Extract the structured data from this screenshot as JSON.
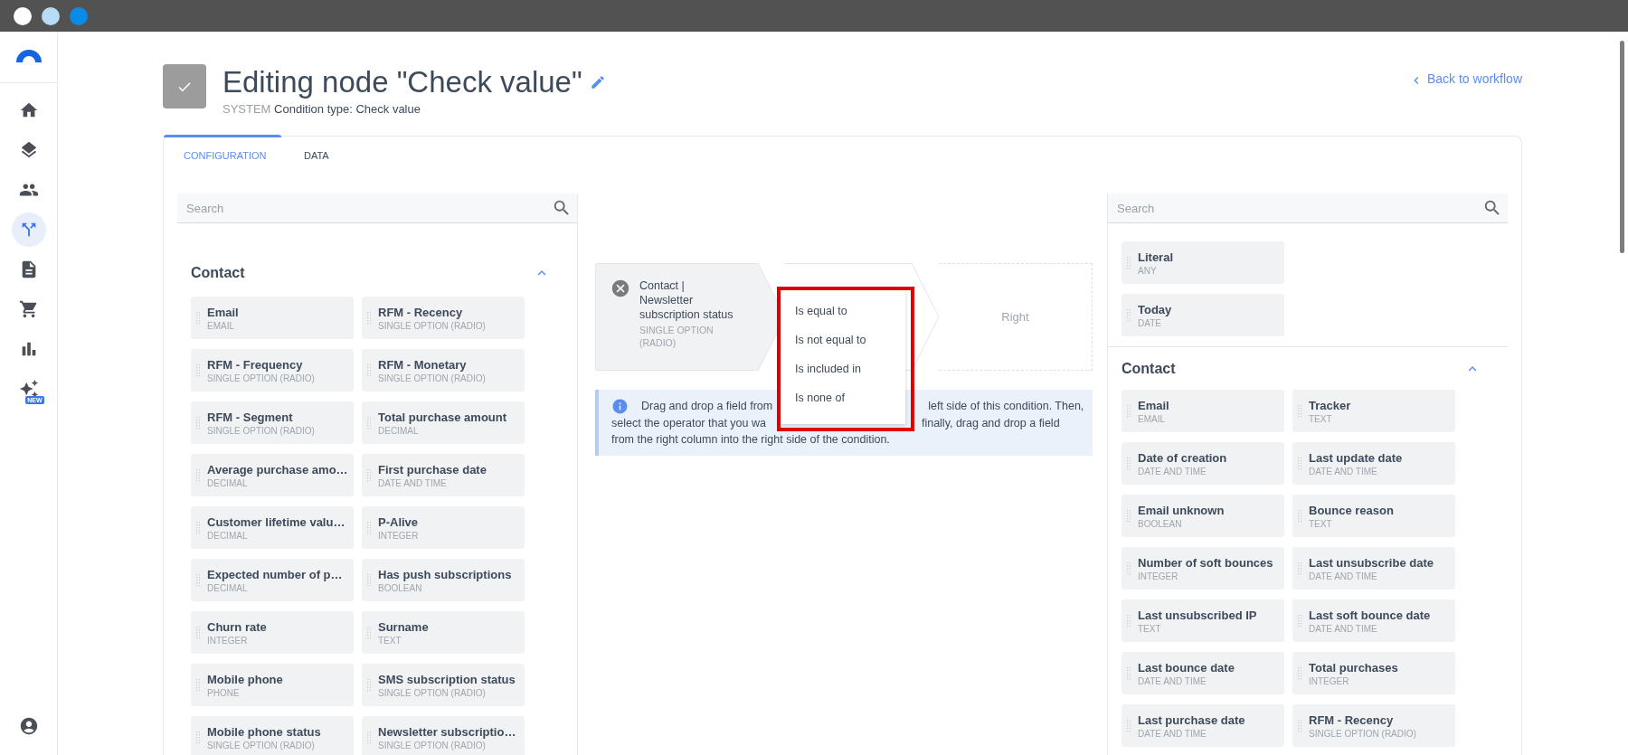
{
  "sidebar": {
    "items": [
      {
        "kind": "home",
        "selected": false
      },
      {
        "kind": "layers",
        "selected": false
      },
      {
        "kind": "people",
        "selected": false
      },
      {
        "kind": "branch",
        "selected": true
      },
      {
        "kind": "document",
        "selected": false
      },
      {
        "kind": "cart",
        "selected": false
      },
      {
        "kind": "chart",
        "selected": false
      },
      {
        "kind": "sparkles",
        "selected": false,
        "badge": "NEW"
      }
    ]
  },
  "header": {
    "title": "Editing node \"Check value\"",
    "subtitle_prefix": "SYSTEM",
    "subtitle": "Condition type: Check value",
    "back_link": "Back to workflow"
  },
  "tabs": [
    {
      "label": "CONFIGURATION",
      "selected": true
    },
    {
      "label": "DATA",
      "selected": false
    }
  ],
  "left_panel": {
    "search_placeholder": "Search",
    "section": {
      "title": "Contact",
      "expanded": true,
      "fields": [
        {
          "name": "Email",
          "type": "EMAIL"
        },
        {
          "name": "RFM - Recency",
          "type": "SINGLE OPTION (RADIO)"
        },
        {
          "name": "RFM - Frequency",
          "type": "SINGLE OPTION (RADIO)"
        },
        {
          "name": "RFM - Monetary",
          "type": "SINGLE OPTION (RADIO)"
        },
        {
          "name": "RFM - Segment",
          "type": "SINGLE OPTION (RADIO)"
        },
        {
          "name": "Total purchase amount",
          "type": "DECIMAL"
        },
        {
          "name": "Average purchase amo…",
          "type": "DECIMAL"
        },
        {
          "name": "First purchase date",
          "type": "DATE AND TIME"
        },
        {
          "name": "Customer lifetime valu…",
          "type": "DECIMAL"
        },
        {
          "name": "P-Alive",
          "type": "INTEGER"
        },
        {
          "name": "Expected number of p…",
          "type": "DECIMAL"
        },
        {
          "name": "Has push subscriptions",
          "type": "BOOLEAN"
        },
        {
          "name": "Churn rate",
          "type": "INTEGER"
        },
        {
          "name": "Surname",
          "type": "TEXT"
        },
        {
          "name": "Mobile phone",
          "type": "PHONE"
        },
        {
          "name": "SMS subscription status",
          "type": "SINGLE OPTION (RADIO)"
        },
        {
          "name": "Mobile phone status",
          "type": "SINGLE OPTION (RADIO)"
        },
        {
          "name": "Newsletter subscriptio…",
          "type": "SINGLE OPTION (RADIO)"
        }
      ]
    }
  },
  "condition": {
    "left": {
      "title": "Contact | Newsletter subscription status",
      "type": "SINGLE OPTION (RADIO)"
    },
    "right_placeholder": "Right"
  },
  "operator_menu": {
    "options": [
      "Is equal to",
      "Is not equal to",
      "Is included in",
      "Is none of"
    ]
  },
  "info": {
    "lines": [
      [
        "Drag and drop a field from",
        "left side of this condition. Then,"
      ],
      [
        "select the operator that you wa",
        "finally, drag and drop a field"
      ],
      [
        "from the right column into the right side of the condition."
      ]
    ]
  },
  "right_panel": {
    "search_placeholder": "Search",
    "constants": [
      {
        "name": "Literal",
        "type": "ANY"
      },
      {
        "name": "Today",
        "type": "DATE"
      }
    ],
    "section": {
      "title": "Contact",
      "expanded": true,
      "fields": [
        {
          "name": "Email",
          "type": "EMAIL"
        },
        {
          "name": "Tracker",
          "type": "TEXT"
        },
        {
          "name": "Date of creation",
          "type": "DATE AND TIME"
        },
        {
          "name": "Last update date",
          "type": "DATE AND TIME"
        },
        {
          "name": "Email unknown",
          "type": "BOOLEAN"
        },
        {
          "name": "Bounce reason",
          "type": "TEXT"
        },
        {
          "name": "Number of soft bounces",
          "type": "INTEGER"
        },
        {
          "name": "Last unsubscribe date",
          "type": "DATE AND TIME"
        },
        {
          "name": "Last unsubscribed IP",
          "type": "TEXT"
        },
        {
          "name": "Last soft bounce date",
          "type": "DATE AND TIME"
        },
        {
          "name": "Last bounce date",
          "type": "DATE AND TIME"
        },
        {
          "name": "Total purchases",
          "type": "INTEGER"
        },
        {
          "name": "Last purchase date",
          "type": "DATE AND TIME"
        },
        {
          "name": "RFM - Recency",
          "type": "SINGLE OPTION (RADIO)"
        }
      ]
    }
  }
}
